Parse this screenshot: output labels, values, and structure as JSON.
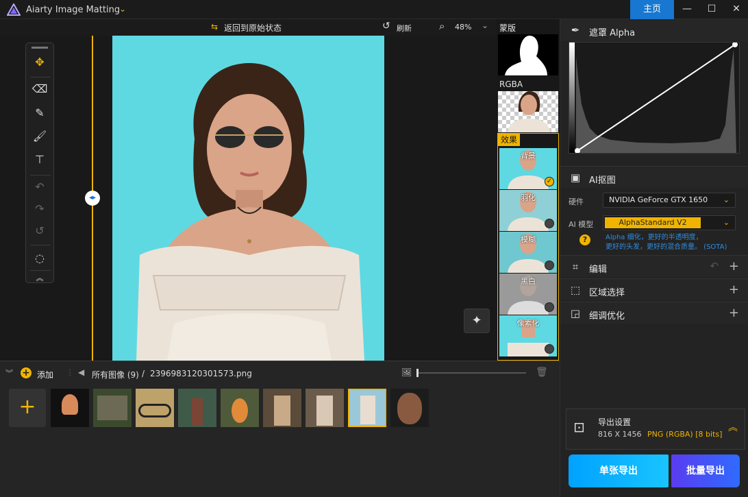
{
  "app": {
    "title": "Aiarty Image Matting",
    "home_label": "主页"
  },
  "canvas_toolbar": {
    "revert_label": "返回到原始状态",
    "refresh_label": "刷新",
    "zoom": "48%"
  },
  "thumbs": {
    "mask_label": "蒙版",
    "rgba_label": "RGBA",
    "effects_label": "效果",
    "effects": [
      {
        "label": "背景",
        "selected": true
      },
      {
        "label": "羽化",
        "selected": false
      },
      {
        "label": "模糊",
        "selected": false
      },
      {
        "label": "黑白",
        "selected": false
      },
      {
        "label": "像素化",
        "selected": false
      }
    ]
  },
  "right": {
    "mask_title": "遮罩 Alpha",
    "ai_title": "AI抠图",
    "hardware_label": "硬件",
    "hardware_value": "NVIDIA GeForce GTX 1650",
    "model_label": "AI 模型",
    "model_value": "AlphaStandard  V2",
    "model_desc_line1": "Alpha 细化，更好的半透明度，",
    "model_desc_line2": "更好的头发，更好的混合质量。 (SOTA)",
    "edit_title": "编辑",
    "region_title": "区域选择",
    "refine_title": "细调优化",
    "export_title": "导出设置",
    "export_size": "816 X 1456",
    "export_format": "PNG (RGBA) [8 bits]",
    "single_export": "单张导出",
    "batch_export": "批量导出"
  },
  "bottom": {
    "add_label": "添加",
    "all_images": "所有图像 (9)",
    "separator": "/",
    "filename": "2396983120301573.png"
  },
  "colors": {
    "accent": "#f0b400",
    "blue": "#1877d0",
    "bg": "#5ed9e2"
  }
}
